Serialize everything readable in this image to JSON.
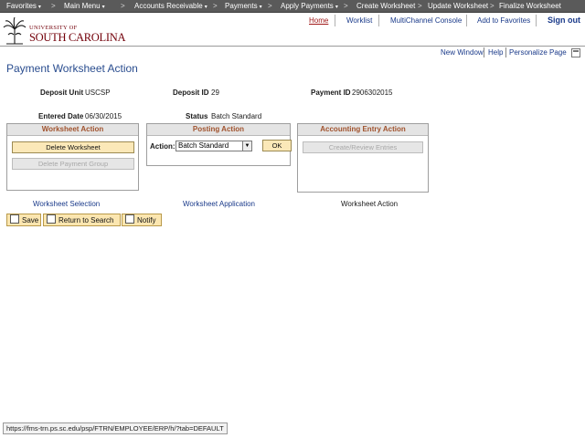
{
  "topnav": {
    "items": [
      {
        "label": "Favorites",
        "caret": "▾"
      },
      {
        "label": "Main Menu",
        "caret": "▾"
      },
      {
        "label": "Accounts Receivable",
        "caret": "▾"
      },
      {
        "label": "Payments",
        "caret": "▾"
      },
      {
        "label": "Apply Payments",
        "caret": "▾"
      },
      {
        "label": "Create Worksheet",
        "caret": ""
      },
      {
        "label": "Update Worksheet",
        "caret": ""
      },
      {
        "label": "Finalize Worksheet",
        "caret": ""
      }
    ],
    "separator": ">"
  },
  "header": {
    "logo_line1": "UNIVERSITY OF",
    "logo_line2": "SOUTH CAROLINA",
    "links": [
      "Home",
      "Worklist",
      "MultiChannel Console",
      "Add to Favorites"
    ],
    "signout": "Sign out",
    "brand_color": "#73000a"
  },
  "pagebar": {
    "new_window": "New Window",
    "help": "Help",
    "personalize": "Personalize Page"
  },
  "page": {
    "title": "Payment Worksheet Action",
    "fields": {
      "deposit_unit_label": "Deposit Unit",
      "deposit_unit_value": "USCSP",
      "deposit_id_label": "Deposit ID",
      "deposit_id_value": "29",
      "payment_id_label": "Payment ID",
      "payment_id_value": "2906302015",
      "entered_date_label": "Entered Date",
      "entered_date_value": "06/30/2015",
      "status_label": "Status",
      "status_value": "Batch Standard"
    }
  },
  "worksheet_action": {
    "title": "Worksheet Action",
    "delete_worksheet": "Delete Worksheet",
    "delete_payment_group": "Delete Payment Group"
  },
  "posting_action": {
    "title": "Posting Action",
    "action_label": "Action:",
    "action_value": "Batch Standard",
    "ok": "OK"
  },
  "accounting_action": {
    "title": "Accounting Entry Action",
    "create_review": "Create/Review Entries"
  },
  "tabs": {
    "selection": "Worksheet Selection",
    "application": "Worksheet Application",
    "current": "Worksheet Action"
  },
  "toolbar": {
    "save": "Save",
    "return": "Return to Search",
    "notify": "Notify"
  },
  "statusbar": {
    "url": "https://fms-trn.ps.sc.edu/psp/FTRN/EMPLOYEE/ERP/h/?tab=DEFAULT"
  }
}
